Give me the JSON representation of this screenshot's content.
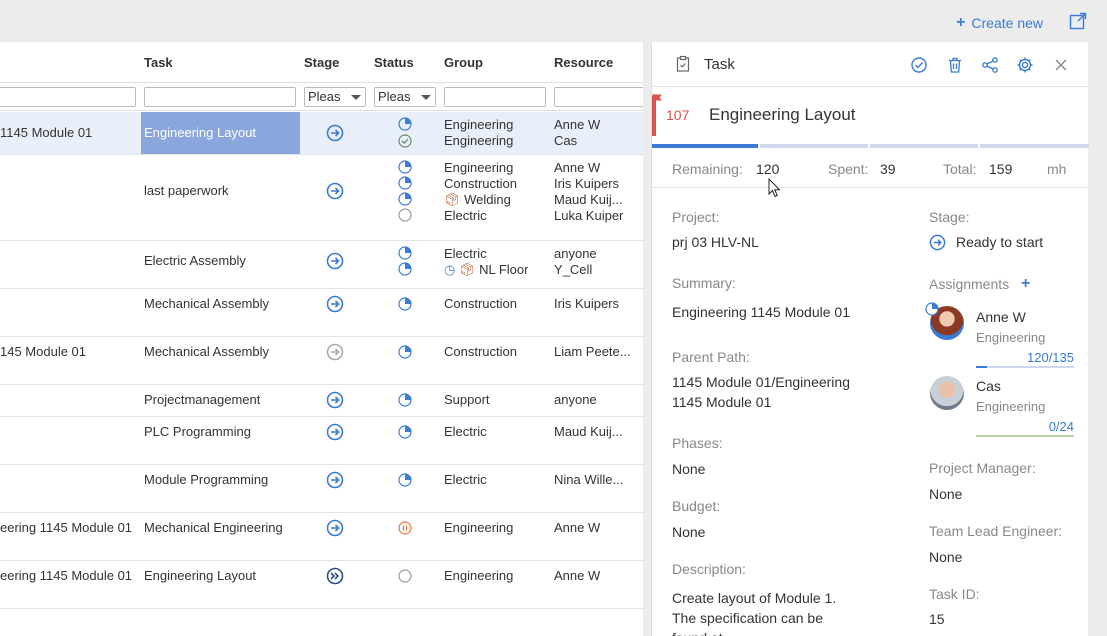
{
  "topbar": {
    "create_new": "Create new"
  },
  "grid": {
    "headers": {
      "task": "Task",
      "stage": "Stage",
      "status": "Status",
      "group": "Group",
      "resource": "Resource"
    },
    "filters": {
      "stage": "Pleas",
      "status": "Pleas"
    },
    "rows": [
      {
        "summary": "1145 Module 01",
        "task": "Engineering Layout",
        "groups": [
          "Engineering",
          "Engineering"
        ],
        "resources": [
          "Anne W",
          "Cas"
        ]
      },
      {
        "summary": "",
        "task": "last paperwork",
        "groups": [
          "Engineering",
          "Construction",
          "Welding",
          "Electric"
        ],
        "resources": [
          "Anne W",
          "Iris Kuipers",
          "Maud Kuij...",
          "Luka Kuiper"
        ]
      },
      {
        "summary": "",
        "task": "Electric Assembly",
        "groups": [
          "Electric",
          "NL Floor"
        ],
        "resources": [
          "anyone",
          "Y_Cell"
        ]
      },
      {
        "summary": "",
        "task": "Mechanical Assembly",
        "groups": [
          "Construction"
        ],
        "resources": [
          "Iris Kuipers"
        ]
      },
      {
        "summary": "145 Module 01",
        "task": "Mechanical Assembly",
        "groups": [
          "Construction"
        ],
        "resources": [
          "Liam Peete..."
        ]
      },
      {
        "summary": "",
        "task": "Projectmanagement",
        "groups": [
          "Support"
        ],
        "resources": [
          "anyone"
        ]
      },
      {
        "summary": "",
        "task": "PLC Programming",
        "groups": [
          "Electric"
        ],
        "resources": [
          "Maud Kuij..."
        ]
      },
      {
        "summary": "",
        "task": "Module Programming",
        "groups": [
          "Electric"
        ],
        "resources": [
          "Nina Wille..."
        ]
      },
      {
        "summary": "eering 1145 Module 01",
        "task": "Mechanical Engineering",
        "groups": [
          "Engineering"
        ],
        "resources": [
          "Anne W"
        ]
      },
      {
        "summary": "eering 1145 Module 01",
        "task": "Engineering Layout",
        "groups": [
          "Engineering"
        ],
        "resources": [
          "Anne W"
        ]
      }
    ]
  },
  "panel": {
    "title": "Task",
    "task_id": "107",
    "task_name": "Engineering Layout",
    "metrics": {
      "remaining_label": "Remaining:",
      "remaining": "120",
      "spent_label": "Spent:",
      "spent": "39",
      "total_label": "Total:",
      "total": "159",
      "unit": "mh"
    },
    "project_label": "Project:",
    "project": "prj 03 HLV-NL",
    "summary_label": "Summary:",
    "summary": "Engineering 1145 Module 01",
    "parent_label": "Parent Path:",
    "parent_1": "1145 Module 01/Engineering",
    "parent_2": "1145 Module 01",
    "phases_label": "Phases:",
    "phases": "None",
    "budget_label": "Budget:",
    "budget": "None",
    "description_label": "Description:",
    "description_1": "Create layout of Module 1.",
    "description_2": "The specification can be",
    "description_3": "found at",
    "stage_label": "Stage:",
    "stage": "Ready to start",
    "assignments_label": "Assignments",
    "assignees": [
      {
        "name": "Anne W",
        "group": "Engineering",
        "hours": "120/135",
        "progress": 0.11
      },
      {
        "name": "Cas",
        "group": "Engineering",
        "hours": "0/24",
        "progress": 0.0
      }
    ],
    "pm_label": "Project Manager:",
    "pm": "None",
    "tle_label": "Team Lead Engineer:",
    "tle": "None",
    "taskid_label": "Task ID:",
    "taskid": "15"
  },
  "colors": {
    "accent": "#3a7bd5",
    "flag": "#d9534f",
    "selected_task": "#8aa6dd"
  }
}
